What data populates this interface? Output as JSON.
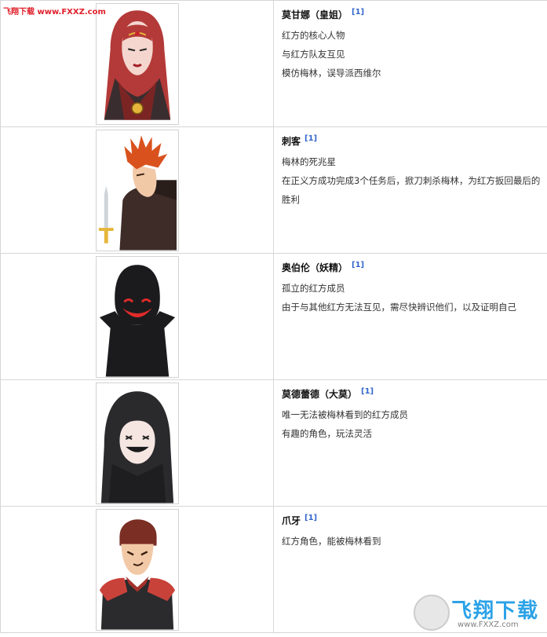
{
  "watermark": {
    "top_left": "飞翔下载 www.FXXZ.com",
    "logo_text": "飞翔下载",
    "logo_url": "www.FXXZ.com"
  },
  "ref_label": "[1]",
  "characters": [
    {
      "name": "莫甘娜（皇姐）",
      "lines": [
        "红方的核心人物",
        "与红方队友互见",
        "模仿梅林，误导派西维尔"
      ],
      "icon": "red-hooded-queen-portrait"
    },
    {
      "name": "刺客",
      "lines": [
        "梅林的死兆星",
        "在正义方成功完成3个任务后，掀刀刺杀梅林，为红方扳回最后的胜利"
      ],
      "icon": "orange-haired-assassin-portrait"
    },
    {
      "name": "奥伯伦（妖精）",
      "lines": [
        "孤立的红方成员",
        "由于与其他红方无法互见，需尽快辨识他们，以及证明自己"
      ],
      "icon": "black-hooded-oberon-portrait"
    },
    {
      "name": "莫德蕾德（大莫）",
      "lines": [
        "唯一无法被梅林看到的红方成员",
        "有趣的角色，玩法灵活"
      ],
      "icon": "dark-hooded-mordred-portrait"
    },
    {
      "name": "爪牙",
      "lines": [
        "红方角色，能被梅林看到"
      ],
      "icon": "red-armored-minion-portrait"
    }
  ],
  "colors": {
    "border": "#d6d6d6",
    "ref_link": "#3366cc",
    "watermark_red": "#e0202c",
    "logo_blue": "#1a9be6"
  }
}
